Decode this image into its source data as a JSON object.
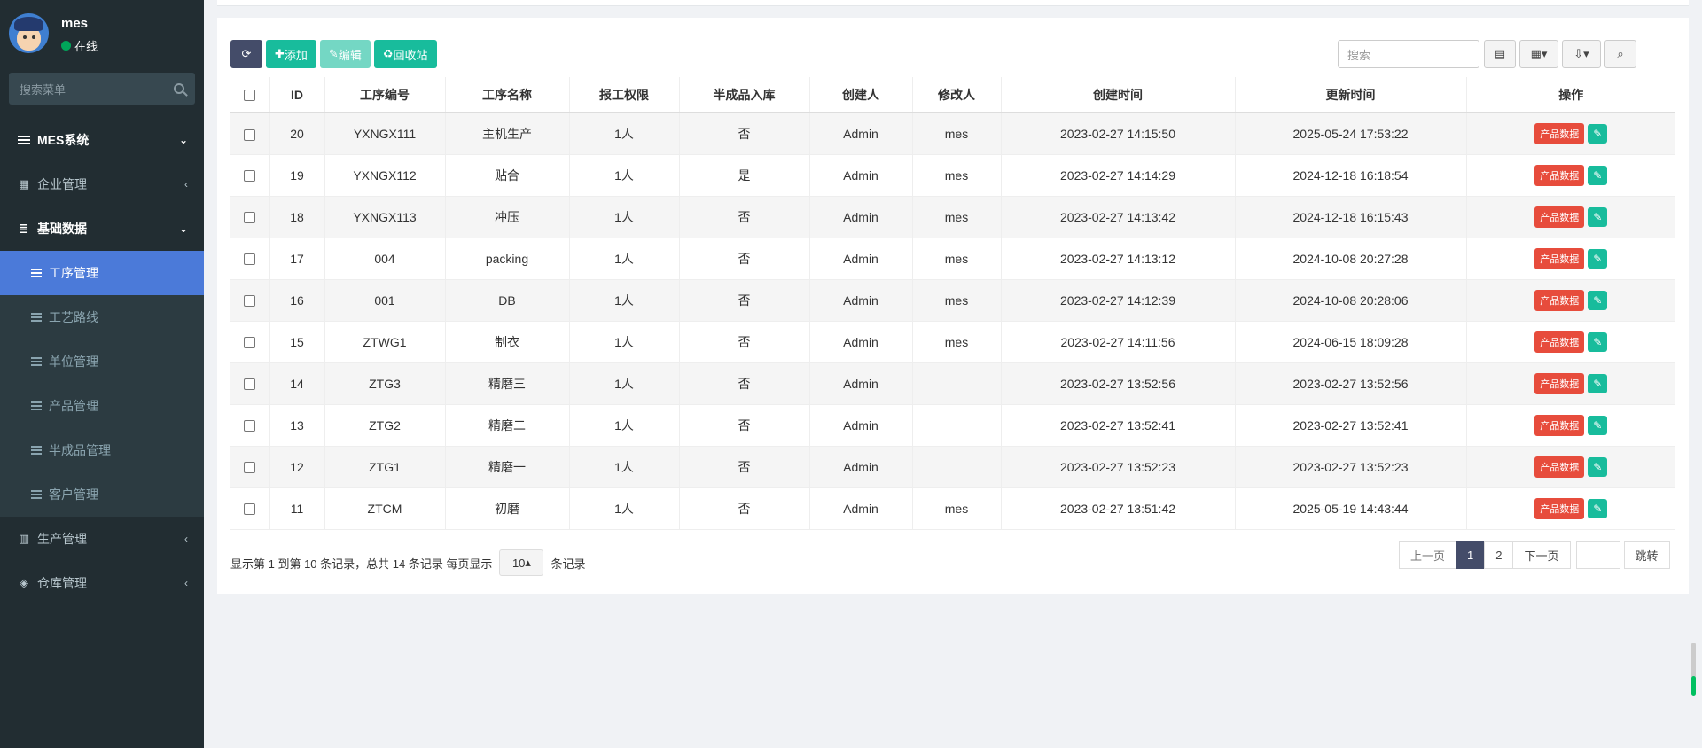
{
  "user": {
    "name": "mes",
    "status": "在线",
    "status_color": "#00a65a"
  },
  "sidebar": {
    "search_placeholder": "搜索菜单",
    "menu": [
      {
        "label": "MES系统",
        "icon": "list-icon",
        "caret": "⌄"
      },
      {
        "label": "企业管理",
        "icon": "building-icon",
        "caret": "‹"
      },
      {
        "label": "基础数据",
        "icon": "database-icon",
        "caret": "⌄"
      }
    ],
    "submenu": [
      {
        "label": "工序管理",
        "active": true
      },
      {
        "label": "工艺路线"
      },
      {
        "label": "单位管理"
      },
      {
        "label": "产品管理"
      },
      {
        "label": "半成品管理"
      },
      {
        "label": "客户管理"
      }
    ],
    "menu_bottom": [
      {
        "label": "生产管理",
        "icon": "factory-icon",
        "caret": "‹"
      },
      {
        "label": "仓库管理",
        "icon": "cube-icon",
        "caret": "‹"
      }
    ]
  },
  "toolbar": {
    "add_label": "添加",
    "edit_label": "编辑",
    "recycle_label": "回收站",
    "search_placeholder": "搜索"
  },
  "table": {
    "columns": [
      "ID",
      "工序编号",
      "工序名称",
      "报工权限",
      "半成品入库",
      "创建人",
      "修改人",
      "创建时间",
      "更新时间",
      "操作"
    ],
    "action_label": "产品数据",
    "rows": [
      {
        "id": "20",
        "code": "YXNGX111",
        "name": "主机生产",
        "perm": "1人",
        "semi": "否",
        "creator": "Admin",
        "modifier": "mes",
        "created": "2023-02-27 14:15:50",
        "updated": "2025-05-24 17:53:22"
      },
      {
        "id": "19",
        "code": "YXNGX112",
        "name": "贴合",
        "perm": "1人",
        "semi": "是",
        "creator": "Admin",
        "modifier": "mes",
        "created": "2023-02-27 14:14:29",
        "updated": "2024-12-18 16:18:54"
      },
      {
        "id": "18",
        "code": "YXNGX113",
        "name": "冲压",
        "perm": "1人",
        "semi": "否",
        "creator": "Admin",
        "modifier": "mes",
        "created": "2023-02-27 14:13:42",
        "updated": "2024-12-18 16:15:43"
      },
      {
        "id": "17",
        "code": "004",
        "name": "packing",
        "perm": "1人",
        "semi": "否",
        "creator": "Admin",
        "modifier": "mes",
        "created": "2023-02-27 14:13:12",
        "updated": "2024-10-08 20:27:28"
      },
      {
        "id": "16",
        "code": "001",
        "name": "DB",
        "perm": "1人",
        "semi": "否",
        "creator": "Admin",
        "modifier": "mes",
        "created": "2023-02-27 14:12:39",
        "updated": "2024-10-08 20:28:06"
      },
      {
        "id": "15",
        "code": "ZTWG1",
        "name": "制衣",
        "perm": "1人",
        "semi": "否",
        "creator": "Admin",
        "modifier": "mes",
        "created": "2023-02-27 14:11:56",
        "updated": "2024-06-15 18:09:28"
      },
      {
        "id": "14",
        "code": "ZTG3",
        "name": "精磨三",
        "perm": "1人",
        "semi": "否",
        "creator": "Admin",
        "modifier": "",
        "created": "2023-02-27 13:52:56",
        "updated": "2023-02-27 13:52:56"
      },
      {
        "id": "13",
        "code": "ZTG2",
        "name": "精磨二",
        "perm": "1人",
        "semi": "否",
        "creator": "Admin",
        "modifier": "",
        "created": "2023-02-27 13:52:41",
        "updated": "2023-02-27 13:52:41"
      },
      {
        "id": "12",
        "code": "ZTG1",
        "name": "精磨一",
        "perm": "1人",
        "semi": "否",
        "creator": "Admin",
        "modifier": "",
        "created": "2023-02-27 13:52:23",
        "updated": "2023-02-27 13:52:23"
      },
      {
        "id": "11",
        "code": "ZTCM",
        "name": "初磨",
        "perm": "1人",
        "semi": "否",
        "creator": "Admin",
        "modifier": "mes",
        "created": "2023-02-27 13:51:42",
        "updated": "2025-05-19 14:43:44"
      }
    ]
  },
  "pager": {
    "info_prefix": "显示第 1 到第 10 条记录，总共 14 条记录 每页显示",
    "page_size": "10",
    "info_suffix": "条记录",
    "prev": "上一页",
    "pages": [
      "1",
      "2"
    ],
    "next": "下一页",
    "go": "跳转"
  }
}
